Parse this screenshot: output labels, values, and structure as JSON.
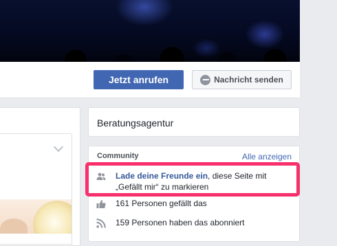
{
  "actions": {
    "call_label": "Jetzt anrufen",
    "message_label": "Nachricht senden",
    "message_icon": "messenger-icon"
  },
  "sidebar": {
    "category": "Beratungsagentur",
    "community": {
      "title": "Community",
      "see_all": "Alle anzeigen",
      "invite": {
        "icon": "friends-icon",
        "link_text": "Lade deine Freunde ein",
        "text_rest": ", diese Seite mit „Gefällt mir“ zu markieren"
      },
      "likes": {
        "icon": "thumbs-up-icon",
        "text": "161 Personen gefällt das"
      },
      "follows": {
        "icon": "rss-icon",
        "text": "159 Personen haben das abonniert"
      }
    }
  },
  "colors": {
    "primary": "#4267b2",
    "link": "#365899",
    "highlight": "#f7306c",
    "background": "#e9ebee"
  }
}
